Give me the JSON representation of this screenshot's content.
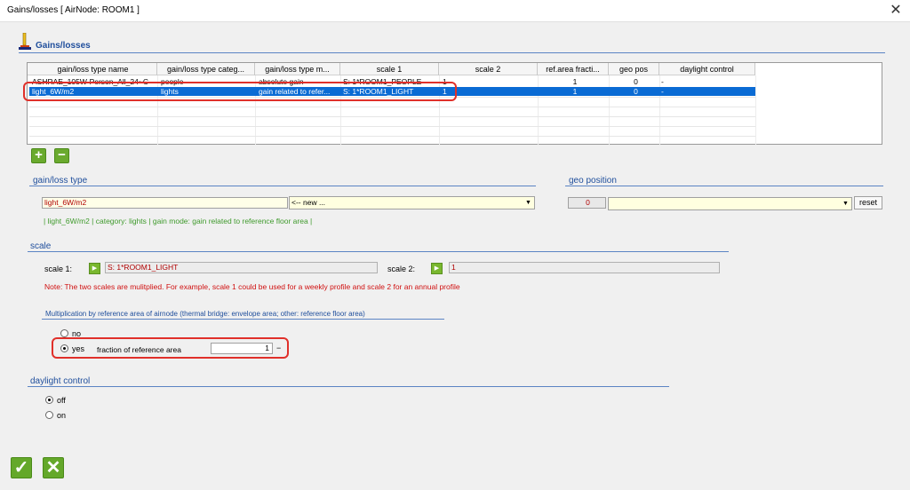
{
  "window": {
    "title": "Gains/losses [ AirNode: ROOM1 ]",
    "close_label": "✕"
  },
  "header": {
    "title": "Gains/losses"
  },
  "table": {
    "columns": [
      "gain/loss type name",
      "gain/loss type categ...",
      "gain/loss type m...",
      "scale 1",
      "scale 2",
      "ref.area fracti...",
      "geo pos",
      "daylight control"
    ],
    "rows": [
      {
        "name": "ASHRAE_105W-Person_All_24~C",
        "category": "people",
        "mode": "absolute gain",
        "scale1": "S: 1*ROOM1_PEOPLE",
        "scale2": "1",
        "fraction": "1",
        "geo": "0",
        "daylight": "-"
      },
      {
        "name": "light_6W/m2",
        "category": "lights",
        "mode": "gain related to refer...",
        "scale1": "S: 1*ROOM1_LIGHT",
        "scale2": "1",
        "fraction": "1",
        "geo": "0",
        "daylight": "-"
      }
    ]
  },
  "buttons": {
    "add": "+",
    "remove": "−",
    "reset": "reset",
    "ok": "✓",
    "cancel": "✕"
  },
  "gain_type": {
    "title": "gain/loss type",
    "name_value": "light_6W/m2",
    "dropdown_value": "<-- new ...",
    "info": "|   light_6W/m2   |   category: lights   |   gain mode: gain related to reference floor area   |"
  },
  "geo": {
    "title": "geo position",
    "value": "0",
    "dropdown_value": ""
  },
  "scale": {
    "title": "scale",
    "scale1_label": "scale 1:",
    "scale1_value": "S: 1*ROOM1_LIGHT",
    "scale2_label": "scale 2:",
    "scale2_value": "1",
    "note": "Note: The two scales are mulitplied. For example, scale 1 could be used for a weekly profile and scale 2 for an annual profile"
  },
  "multiplication": {
    "title": "Multiplication by reference area of airnode (thermal bridge: envelope area; other: reference floor area)",
    "no_label": "no",
    "yes_label": "yes",
    "fraction_label": "fraction of reference area",
    "fraction_value": "1",
    "fraction_unit": "−"
  },
  "daylight": {
    "title": "daylight control",
    "off_label": "off",
    "on_label": "on"
  }
}
